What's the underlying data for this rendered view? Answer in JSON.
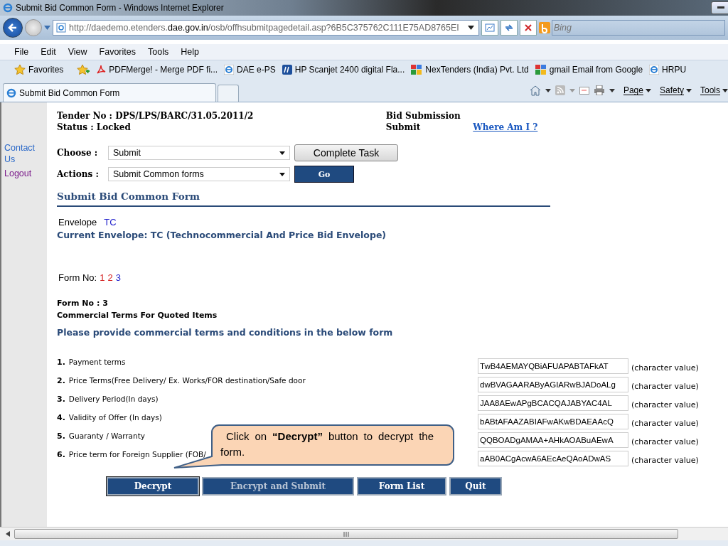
{
  "window": {
    "title": "Submit Bid Common Form - Windows Internet Explorer"
  },
  "address_bar": {
    "url_prefix": "http://daedemo.etenders.",
    "url_domain": "dae.gov.in",
    "url_suffix": "/osb/offhsubmitpagedetail.asp?6B5C375762C111E75AD8765EI"
  },
  "search_box": {
    "placeholder": "Bing"
  },
  "menu_bar": [
    "File",
    "Edit",
    "View",
    "Favorites",
    "Tools",
    "Help"
  ],
  "favorites_bar": {
    "label": "Favorites",
    "links": [
      {
        "label": "PDFMerge! - Merge PDF fi...",
        "kind": "pdf"
      },
      {
        "label": "DAE e-PS",
        "kind": "ie"
      },
      {
        "label": "HP Scanjet 2400 digital Fla...",
        "kind": "hp"
      },
      {
        "label": "NexTenders (India) Pvt. Ltd",
        "kind": "google"
      },
      {
        "label": "gmail Email from Google",
        "kind": "google"
      },
      {
        "label": "HRPU",
        "kind": "ie"
      }
    ]
  },
  "tabs": [
    {
      "label": "Submit Bid Common Form",
      "selected": true
    }
  ],
  "command_bar": [
    "Page",
    "Safety",
    "Tools"
  ],
  "sidebar": {
    "links": [
      {
        "label": "Contact Us",
        "visited": false
      },
      {
        "label": "Logout",
        "visited": true
      }
    ]
  },
  "header": {
    "tender": "Tender No : DPS/LPS/BARC/31.05.2011/2",
    "status": "Status : Locked",
    "stage": "Bid Submission",
    "stage_status": "Submit",
    "link": "Where Am I ?"
  },
  "controls": [
    {
      "label": "Choose :",
      "value": "Submit",
      "button": "Complete Task",
      "kind": "plain"
    },
    {
      "label": "Actions :",
      "value": "Submit Common forms",
      "button": "Go",
      "kind": "dark"
    }
  ],
  "section_title": "Submit Bid Common Form",
  "envelope": {
    "label": "Envelope",
    "value": "TC"
  },
  "current_envelope": "Current Envelope: TC (Technocommercial And Price Bid Envelope)",
  "form_no": {
    "label": "Form No:",
    "forms": [
      {
        "label": "1",
        "selected": false
      },
      {
        "label": "2",
        "selected": false
      },
      {
        "label": "3",
        "selected": true
      }
    ]
  },
  "form_heading": "Form No : 3",
  "form_subtitle": "Commercial Terms For Quoted Items",
  "instruction": "Please provide commercial terms and conditions in the below form",
  "rows": [
    {
      "number": "1.",
      "label": "Payment terms",
      "value": "TwB4AEMAYQBiAFUAPABTAFkAT",
      "hint": "(character value)"
    },
    {
      "number": "2.",
      "label": "Price Terms(Free Delivery/ Ex. Works/FOR destination/Safe door",
      "value": "dwBVAGAARAByAGIARwBJADoALg",
      "hint": "(character value)"
    },
    {
      "number": "3.",
      "label": "Delivery Period(In days)",
      "value": "JAA8AEwAPgBCACQAJABYAC4AL",
      "hint": "(character value)"
    },
    {
      "number": "4.",
      "label": "Validity of Offer (In days)",
      "value": "bABtAFAAZABIAFwAKwBDAEAAcQ",
      "hint": "(character value)"
    },
    {
      "number": "5.",
      "label": "Guaranty / Warranty",
      "value": "QQBOADgAMAA+AHkAOABuAEwA",
      "hint": "(character value)"
    },
    {
      "number": "6.",
      "label": "Price term for Foreign Supplier (FOB/",
      "value": "aAB0ACgAcwA6AEcAeQAoADwAS",
      "hint": "(character value)"
    }
  ],
  "buttons": [
    {
      "label": "Decrypt",
      "disabled": false,
      "focused": true
    },
    {
      "label": "Encrypt and Submit",
      "disabled": true,
      "focused": false
    },
    {
      "label": "Form List",
      "disabled": false,
      "focused": false
    },
    {
      "label": "Quit",
      "disabled": false,
      "focused": false
    }
  ],
  "callout": {
    "text": "Click on **“Decrypt”** button to decrypt the form."
  }
}
